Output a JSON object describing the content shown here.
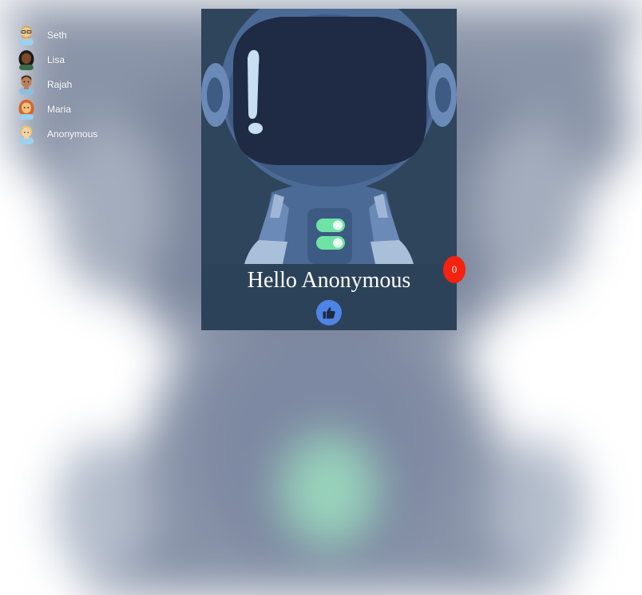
{
  "users": [
    {
      "name": "Seth",
      "icon": "man-with-glasses-avatar-icon"
    },
    {
      "name": "Lisa",
      "icon": "dark-skin-woman-avatar-icon"
    },
    {
      "name": "Rajah",
      "icon": "medium-skin-man-avatar-icon"
    },
    {
      "name": "Maria",
      "icon": "red-hair-woman-avatar-icon"
    },
    {
      "name": "Anonymous",
      "icon": "blonde-person-avatar-icon"
    }
  ],
  "card": {
    "image": "astronaut-icon",
    "greeting": "Hello Anonymous",
    "like_icon": "thumbs-up-icon",
    "like_count": "0"
  },
  "colors": {
    "card_bg": "#2c4259",
    "like_button": "#4f84e6",
    "badge": "#f5220f",
    "toggle_green": "#6fe3a5"
  }
}
